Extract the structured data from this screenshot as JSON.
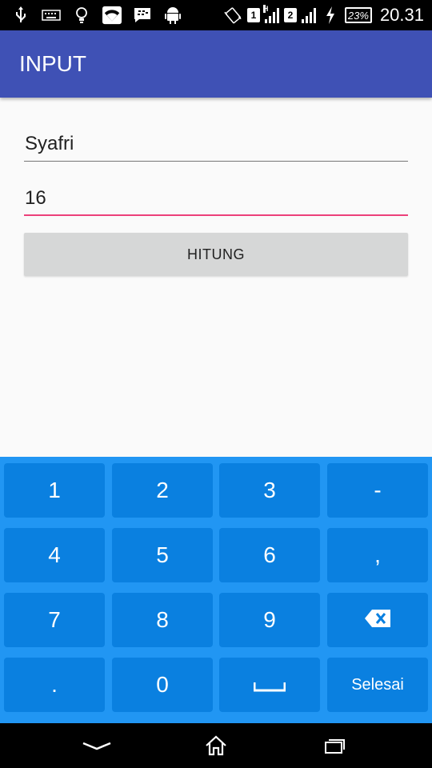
{
  "status_bar": {
    "sim1": "1",
    "sim2": "2",
    "network_type": "H",
    "battery": "23%",
    "time": "20.31",
    "icons": [
      "usb-icon",
      "keyboard-icon",
      "bulb-icon",
      "wifi-icon",
      "bbm-icon",
      "android-icon",
      "vibrate-icon",
      "charging-icon"
    ]
  },
  "app_bar": {
    "title": "INPUT"
  },
  "form": {
    "name_value": "Syafri",
    "age_value": "16",
    "button_label": "HITUNG"
  },
  "colors": {
    "primary": "#3f51b5",
    "accent": "#ec407a",
    "keyboard_bg": "#2196f3",
    "key_bg": "#0a80e0"
  },
  "keyboard": {
    "rows": [
      [
        "1",
        "2",
        "3",
        "-"
      ],
      [
        "4",
        "5",
        "6",
        ","
      ],
      [
        "7",
        "8",
        "9",
        "backspace"
      ],
      [
        ".",
        "0",
        "space",
        "Selesai"
      ]
    ],
    "k1": "1",
    "k2": "2",
    "k3": "3",
    "k_dash": "-",
    "k4": "4",
    "k5": "5",
    "k6": "6",
    "k_comma": ",",
    "k7": "7",
    "k8": "8",
    "k9": "9",
    "k_dot": ".",
    "k0": "0",
    "k_done": "Selesai"
  },
  "nav_bar": {
    "icons": [
      "back-icon",
      "home-icon",
      "recents-icon"
    ]
  }
}
